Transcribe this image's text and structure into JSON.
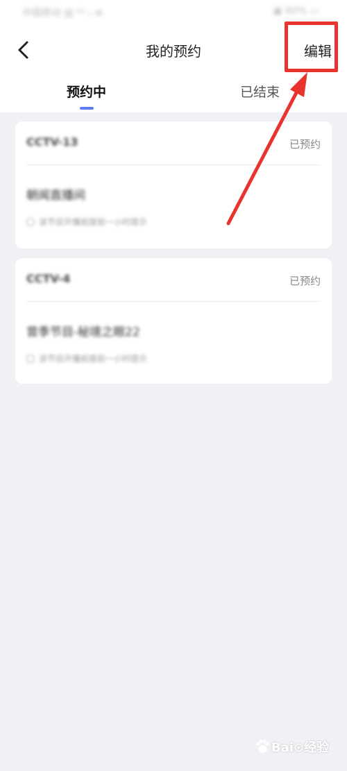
{
  "status_bar": {
    "left_text": "中国移动 ▨ ⁴ᴳ ᵢₗ ⊕",
    "right_text": "▣ 80% ▭"
  },
  "nav": {
    "title": "我的预约",
    "edit_label": "编辑",
    "back_icon": "chevron-left-icon"
  },
  "tabs": [
    {
      "label": "预约中",
      "active": true
    },
    {
      "label": "已结束",
      "active": false
    }
  ],
  "reservations": [
    {
      "channel": "CCTV-13",
      "status": "已预约",
      "program": "朝闻直播间",
      "reminder": "该节目开播前提前一小时提示"
    },
    {
      "channel": "CCTV-4",
      "status": "已预约",
      "program": "曾季节目-秘境之眼22",
      "reminder": "该节目开播前提前一小时提示"
    }
  ],
  "watermark": {
    "text": "Bai⊛经验"
  },
  "colors": {
    "accent": "#5a7ef0",
    "highlight": "#e8332f",
    "background": "#eff1f5"
  }
}
